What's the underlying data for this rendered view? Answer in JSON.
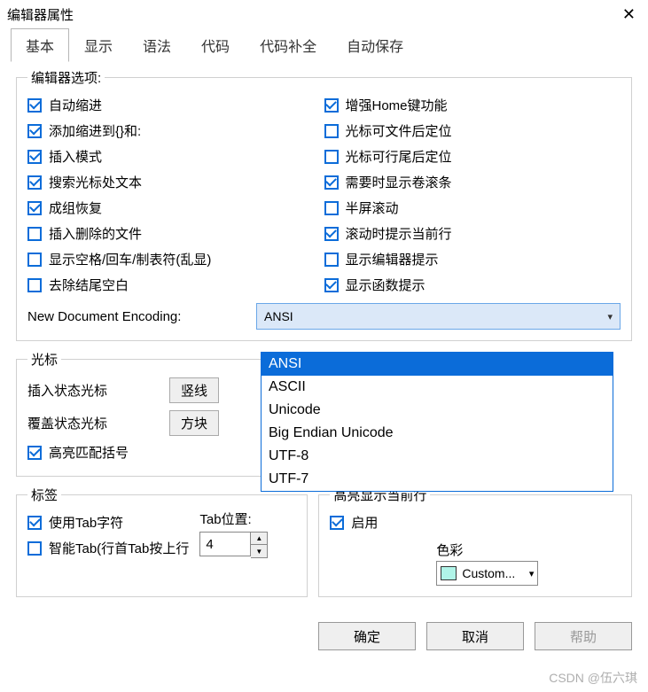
{
  "window": {
    "title": "编辑器属性"
  },
  "tabs": [
    "基本",
    "显示",
    "语法",
    "代码",
    "代码补全",
    "自动保存"
  ],
  "activeTab": 0,
  "group_options": {
    "legend": "编辑器选项:",
    "left": [
      {
        "label": "自动缩进",
        "checked": true
      },
      {
        "label": "添加缩进到{}和:",
        "checked": true
      },
      {
        "label": "插入模式",
        "checked": true
      },
      {
        "label": "搜索光标处文本",
        "checked": true
      },
      {
        "label": "成组恢复",
        "checked": true
      },
      {
        "label": "插入删除的文件",
        "checked": false
      },
      {
        "label": "显示空格/回车/制表符(乱显)",
        "checked": false
      },
      {
        "label": "去除结尾空白",
        "checked": false
      }
    ],
    "right": [
      {
        "label": "增强Home键功能",
        "checked": true
      },
      {
        "label": "光标可文件后定位",
        "checked": false
      },
      {
        "label": "光标可行尾后定位",
        "checked": false
      },
      {
        "label": "需要时显示卷滚条",
        "checked": true
      },
      {
        "label": "半屏滚动",
        "checked": false
      },
      {
        "label": "滚动时提示当前行",
        "checked": true
      },
      {
        "label": "显示编辑器提示",
        "checked": false
      },
      {
        "label": "显示函数提示",
        "checked": true
      }
    ],
    "encoding_label": "New Document Encoding:",
    "encoding_value": "ANSI",
    "encoding_options": [
      "ANSI",
      "ASCII",
      "Unicode",
      "Big Endian Unicode",
      "UTF-8",
      "UTF-7"
    ]
  },
  "group_cursor": {
    "legend": "光标",
    "insert_label": "插入状态光标",
    "insert_btn": "竖线",
    "overwrite_label": "覆盖状态光标",
    "overwrite_btn": "方块",
    "highlight_bracket": {
      "label": "高亮匹配括号",
      "checked": true
    }
  },
  "group_tabs": {
    "legend": "标签",
    "use_tab": {
      "label": "使用Tab字符",
      "checked": true
    },
    "smart_tab": {
      "label": "智能Tab(行首Tab按上行",
      "checked": false
    },
    "tab_pos_label": "Tab位置:",
    "tab_pos_value": "4"
  },
  "group_highlight": {
    "legend": "高亮显示当前行",
    "enable": {
      "label": "启用",
      "checked": true
    },
    "color_label": "色彩",
    "color_value": "Custom..."
  },
  "buttons": {
    "ok": "确定",
    "cancel": "取消",
    "help": "帮助"
  },
  "watermark": "CSDN @伍六琪"
}
